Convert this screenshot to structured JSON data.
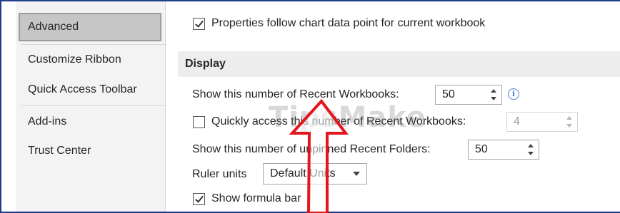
{
  "sidebar": {
    "items": [
      {
        "label": "Advanced",
        "active": true
      },
      {
        "label": "Customize Ribbon",
        "active": false
      },
      {
        "label": "Quick Access Toolbar",
        "active": false
      },
      {
        "label": "Add-ins",
        "active": false
      },
      {
        "label": "Trust Center",
        "active": false
      }
    ]
  },
  "main": {
    "properties_follow": {
      "label": "Properties follow chart data point for current workbook",
      "checked": true
    },
    "section_display": "Display",
    "recent_workbooks": {
      "label": "Show this number of Recent Workbooks:",
      "value": "50"
    },
    "quick_access": {
      "label": "Quickly access this number of Recent Workbooks:",
      "value": "4",
      "checked": false
    },
    "unpinned_folders": {
      "label": "Show this number of unpinned Recent Folders:",
      "value": "50"
    },
    "ruler_units": {
      "label": "Ruler units",
      "value": "Default Units"
    },
    "formula_bar": {
      "label": "Show formula bar",
      "checked": true
    }
  },
  "watermark": "TipsMake",
  "colors": {
    "frame": "#1f3f8a",
    "sidebar_bg": "#f3f3f3",
    "active_bg": "#c6c6c6",
    "section_bg": "#ededed",
    "annotation_arrow": "#e4151b",
    "info_icon": "#4a86c8"
  },
  "icons": [
    "checkbox-checked",
    "checkbox-unchecked",
    "spinner-arrows",
    "info-icon",
    "dropdown-chevron-icon",
    "annotation-arrow"
  ]
}
